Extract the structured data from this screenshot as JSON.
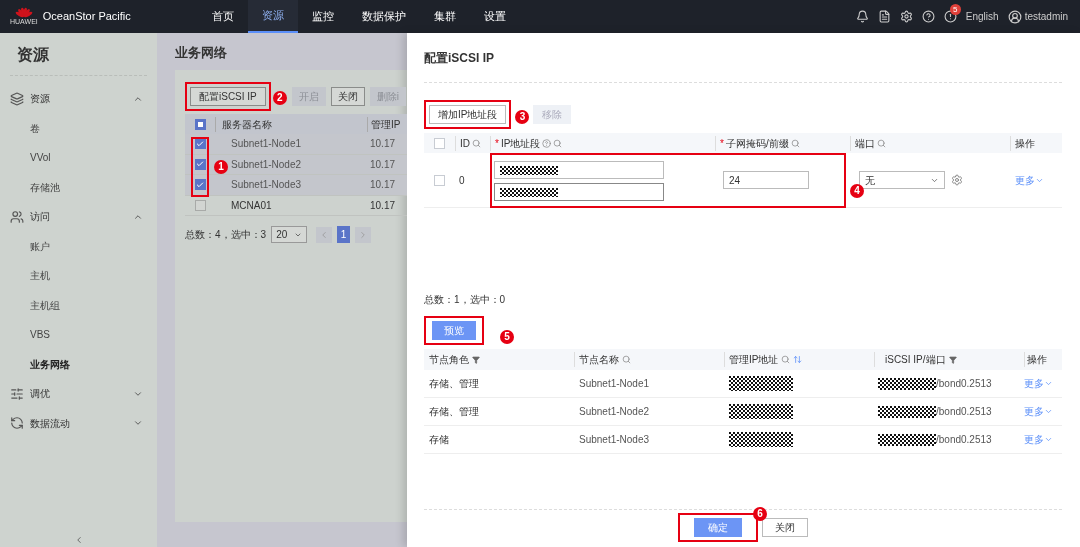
{
  "topbar": {
    "logo_text": "HUAWEI",
    "brand": "OceanStor Pacific",
    "nav": [
      {
        "label": "首页",
        "selected": false
      },
      {
        "label": "资源",
        "selected": true
      },
      {
        "label": "监控",
        "selected": false
      },
      {
        "label": "数据保护",
        "selected": false
      },
      {
        "label": "集群",
        "selected": false
      },
      {
        "label": "设置",
        "selected": false
      }
    ],
    "alert_count": "5",
    "language": "English",
    "user": "testadmin"
  },
  "sidebar": {
    "title": "资源",
    "groups": [
      {
        "label": "资源",
        "expanded": true,
        "children": [
          {
            "label": "卷",
            "selected": false
          },
          {
            "label": "VVol",
            "selected": false
          },
          {
            "label": "存储池",
            "selected": false
          }
        ]
      },
      {
        "label": "访问",
        "expanded": true,
        "children": [
          {
            "label": "账户",
            "selected": false
          },
          {
            "label": "主机",
            "selected": false
          },
          {
            "label": "主机组",
            "selected": false
          },
          {
            "label": "VBS",
            "selected": false
          },
          {
            "label": "业务网络",
            "selected": true
          }
        ]
      },
      {
        "label": "调优",
        "expanded": false
      },
      {
        "label": "数据流动",
        "expanded": false
      }
    ]
  },
  "page": {
    "title": "业务网络",
    "toolbar": [
      {
        "label": "配置iSCSI IP",
        "disabled": false,
        "annotation": "2"
      },
      {
        "label": "开启",
        "disabled": true
      },
      {
        "label": "关闭",
        "disabled": false
      },
      {
        "label": "删除i",
        "disabled": true
      }
    ],
    "header_checkbox": {
      "indeterminate": true
    },
    "columns": [
      "服务器名称",
      "管理IP"
    ],
    "checkbox_annotation": "1",
    "rows": [
      {
        "name": "Subnet1-Node1",
        "ip": "10.17",
        "checked": true
      },
      {
        "name": "Subnet1-Node2",
        "ip": "10.17",
        "checked": true
      },
      {
        "name": "Subnet1-Node3",
        "ip": "10.17",
        "checked": true
      },
      {
        "name": "MCNA01",
        "ip": "10.17",
        "checked": false
      }
    ],
    "summary": "总数：4，选中：3",
    "page_size": "20",
    "pages": [
      {
        "label": "1",
        "selected": true
      }
    ]
  },
  "drawer": {
    "title": "配置iSCSI IP",
    "actions": [
      {
        "label": "增加IP地址段",
        "disabled": false,
        "annotation": "3"
      },
      {
        "label": "移除",
        "disabled": true
      }
    ],
    "header_checkbox": {
      "checked": false
    },
    "columns": [
      {
        "label": "ID"
      },
      {
        "label": "IP地址段",
        "mark": "*"
      },
      {
        "label": "子网掩码/前缀",
        "mark": "*"
      },
      {
        "label": "端口"
      },
      {
        "label": "操作"
      }
    ],
    "rows": [
      {
        "id": "0",
        "checked": false,
        "mask": "24",
        "port": "无",
        "more": "更多"
      }
    ],
    "row_annotation": "4",
    "summary": "总数：1，选中：0",
    "preview": {
      "label": "预览",
      "annotation": "5"
    },
    "preview_columns": [
      "节点角色",
      "节点名称",
      "管理IP地址",
      "iSCSI IP/端口",
      "操作"
    ],
    "preview_rows": [
      {
        "role": "存储、管理",
        "name": "Subnet1-Node1",
        "port": "/bond0.2513",
        "more": "更多"
      },
      {
        "role": "存储、管理",
        "name": "Subnet1-Node2",
        "port": "/bond0.2513",
        "more": "更多"
      },
      {
        "role": "存储",
        "name": "Subnet1-Node3",
        "port": "/bond0.2513",
        "more": "更多"
      }
    ],
    "confirm": {
      "label": "确定",
      "annotation": "6"
    },
    "close": "关闭"
  }
}
